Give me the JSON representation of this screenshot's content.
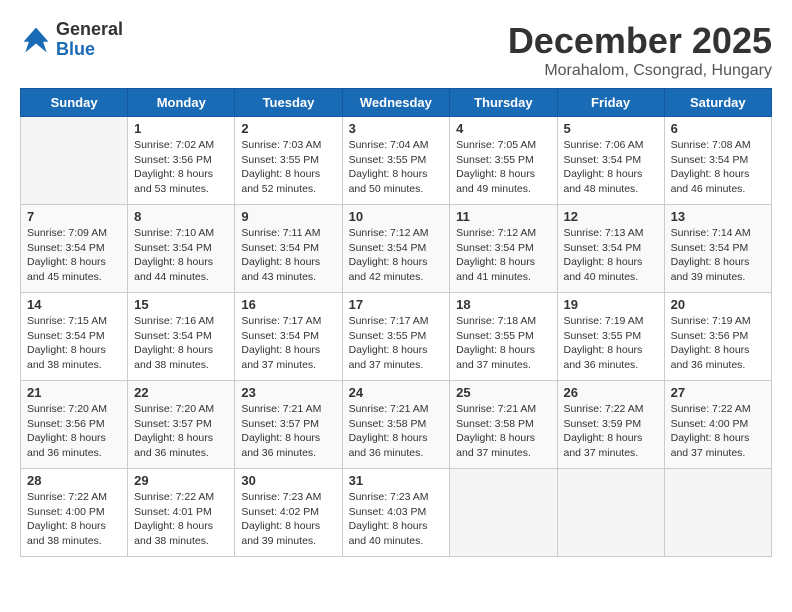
{
  "logo": {
    "general": "General",
    "blue": "Blue"
  },
  "header": {
    "month": "December 2025",
    "location": "Morahalom, Csongrad, Hungary"
  },
  "weekdays": [
    "Sunday",
    "Monday",
    "Tuesday",
    "Wednesday",
    "Thursday",
    "Friday",
    "Saturday"
  ],
  "weeks": [
    [
      {
        "day": "",
        "info": ""
      },
      {
        "day": "1",
        "info": "Sunrise: 7:02 AM\nSunset: 3:56 PM\nDaylight: 8 hours\nand 53 minutes."
      },
      {
        "day": "2",
        "info": "Sunrise: 7:03 AM\nSunset: 3:55 PM\nDaylight: 8 hours\nand 52 minutes."
      },
      {
        "day": "3",
        "info": "Sunrise: 7:04 AM\nSunset: 3:55 PM\nDaylight: 8 hours\nand 50 minutes."
      },
      {
        "day": "4",
        "info": "Sunrise: 7:05 AM\nSunset: 3:55 PM\nDaylight: 8 hours\nand 49 minutes."
      },
      {
        "day": "5",
        "info": "Sunrise: 7:06 AM\nSunset: 3:54 PM\nDaylight: 8 hours\nand 48 minutes."
      },
      {
        "day": "6",
        "info": "Sunrise: 7:08 AM\nSunset: 3:54 PM\nDaylight: 8 hours\nand 46 minutes."
      }
    ],
    [
      {
        "day": "7",
        "info": "Sunrise: 7:09 AM\nSunset: 3:54 PM\nDaylight: 8 hours\nand 45 minutes."
      },
      {
        "day": "8",
        "info": "Sunrise: 7:10 AM\nSunset: 3:54 PM\nDaylight: 8 hours\nand 44 minutes."
      },
      {
        "day": "9",
        "info": "Sunrise: 7:11 AM\nSunset: 3:54 PM\nDaylight: 8 hours\nand 43 minutes."
      },
      {
        "day": "10",
        "info": "Sunrise: 7:12 AM\nSunset: 3:54 PM\nDaylight: 8 hours\nand 42 minutes."
      },
      {
        "day": "11",
        "info": "Sunrise: 7:12 AM\nSunset: 3:54 PM\nDaylight: 8 hours\nand 41 minutes."
      },
      {
        "day": "12",
        "info": "Sunrise: 7:13 AM\nSunset: 3:54 PM\nDaylight: 8 hours\nand 40 minutes."
      },
      {
        "day": "13",
        "info": "Sunrise: 7:14 AM\nSunset: 3:54 PM\nDaylight: 8 hours\nand 39 minutes."
      }
    ],
    [
      {
        "day": "14",
        "info": "Sunrise: 7:15 AM\nSunset: 3:54 PM\nDaylight: 8 hours\nand 38 minutes."
      },
      {
        "day": "15",
        "info": "Sunrise: 7:16 AM\nSunset: 3:54 PM\nDaylight: 8 hours\nand 38 minutes."
      },
      {
        "day": "16",
        "info": "Sunrise: 7:17 AM\nSunset: 3:54 PM\nDaylight: 8 hours\nand 37 minutes."
      },
      {
        "day": "17",
        "info": "Sunrise: 7:17 AM\nSunset: 3:55 PM\nDaylight: 8 hours\nand 37 minutes."
      },
      {
        "day": "18",
        "info": "Sunrise: 7:18 AM\nSunset: 3:55 PM\nDaylight: 8 hours\nand 37 minutes."
      },
      {
        "day": "19",
        "info": "Sunrise: 7:19 AM\nSunset: 3:55 PM\nDaylight: 8 hours\nand 36 minutes."
      },
      {
        "day": "20",
        "info": "Sunrise: 7:19 AM\nSunset: 3:56 PM\nDaylight: 8 hours\nand 36 minutes."
      }
    ],
    [
      {
        "day": "21",
        "info": "Sunrise: 7:20 AM\nSunset: 3:56 PM\nDaylight: 8 hours\nand 36 minutes."
      },
      {
        "day": "22",
        "info": "Sunrise: 7:20 AM\nSunset: 3:57 PM\nDaylight: 8 hours\nand 36 minutes."
      },
      {
        "day": "23",
        "info": "Sunrise: 7:21 AM\nSunset: 3:57 PM\nDaylight: 8 hours\nand 36 minutes."
      },
      {
        "day": "24",
        "info": "Sunrise: 7:21 AM\nSunset: 3:58 PM\nDaylight: 8 hours\nand 36 minutes."
      },
      {
        "day": "25",
        "info": "Sunrise: 7:21 AM\nSunset: 3:58 PM\nDaylight: 8 hours\nand 37 minutes."
      },
      {
        "day": "26",
        "info": "Sunrise: 7:22 AM\nSunset: 3:59 PM\nDaylight: 8 hours\nand 37 minutes."
      },
      {
        "day": "27",
        "info": "Sunrise: 7:22 AM\nSunset: 4:00 PM\nDaylight: 8 hours\nand 37 minutes."
      }
    ],
    [
      {
        "day": "28",
        "info": "Sunrise: 7:22 AM\nSunset: 4:00 PM\nDaylight: 8 hours\nand 38 minutes."
      },
      {
        "day": "29",
        "info": "Sunrise: 7:22 AM\nSunset: 4:01 PM\nDaylight: 8 hours\nand 38 minutes."
      },
      {
        "day": "30",
        "info": "Sunrise: 7:23 AM\nSunset: 4:02 PM\nDaylight: 8 hours\nand 39 minutes."
      },
      {
        "day": "31",
        "info": "Sunrise: 7:23 AM\nSunset: 4:03 PM\nDaylight: 8 hours\nand 40 minutes."
      },
      {
        "day": "",
        "info": ""
      },
      {
        "day": "",
        "info": ""
      },
      {
        "day": "",
        "info": ""
      }
    ]
  ]
}
